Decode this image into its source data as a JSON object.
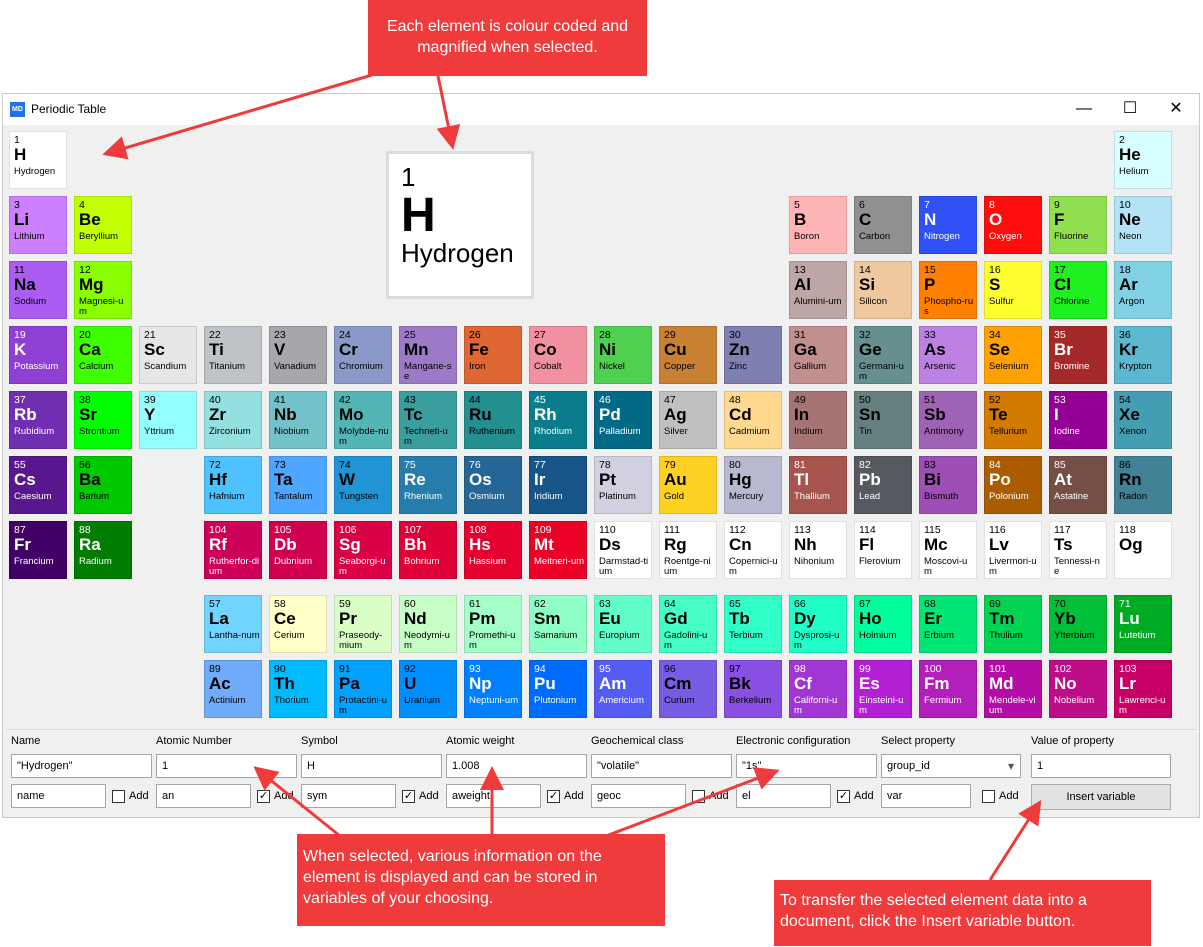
{
  "window": {
    "title": "Periodic Table",
    "app_icon": "MD",
    "controls": [
      "—",
      "☐",
      "✕"
    ]
  },
  "selected": {
    "number": "1",
    "symbol": "H",
    "name": "Hydrogen"
  },
  "elements": [
    {
      "n": "1",
      "s": "H",
      "name": "Hydrogen",
      "c": "#ffffff",
      "r": 0,
      "col": 0
    },
    {
      "n": "2",
      "s": "He",
      "name": "Helium",
      "c": "#d8ffff",
      "r": 0,
      "col": 17
    },
    {
      "n": "3",
      "s": "Li",
      "name": "Lithium",
      "c": "#cc80ff",
      "r": 1,
      "col": 0
    },
    {
      "n": "4",
      "s": "Be",
      "name": "Beryllium",
      "c": "#c2ff00",
      "r": 1,
      "col": 1
    },
    {
      "n": "5",
      "s": "B",
      "name": "Boron",
      "c": "#ffb5b5",
      "r": 1,
      "col": 12
    },
    {
      "n": "6",
      "s": "C",
      "name": "Carbon",
      "c": "#909090",
      "r": 1,
      "col": 13
    },
    {
      "n": "7",
      "s": "N",
      "name": "Nitrogen",
      "c": "#3050f8",
      "r": 1,
      "col": 14
    },
    {
      "n": "8",
      "s": "O",
      "name": "Oxygen",
      "c": "#ff0d0d",
      "r": 1,
      "col": 15
    },
    {
      "n": "9",
      "s": "F",
      "name": "Fluorine",
      "c": "#90e050",
      "r": 1,
      "col": 16
    },
    {
      "n": "10",
      "s": "Ne",
      "name": "Neon",
      "c": "#b3e3f5",
      "r": 1,
      "col": 17
    },
    {
      "n": "11",
      "s": "Na",
      "name": "Sodium",
      "c": "#ab5cf2",
      "r": 2,
      "col": 0
    },
    {
      "n": "12",
      "s": "Mg",
      "name": "Magnesi-um",
      "c": "#8aff00",
      "r": 2,
      "col": 1
    },
    {
      "n": "13",
      "s": "Al",
      "name": "Alumini-um",
      "c": "#bfa6a6",
      "r": 2,
      "col": 12
    },
    {
      "n": "14",
      "s": "Si",
      "name": "Silicon",
      "c": "#f0c8a0",
      "r": 2,
      "col": 13
    },
    {
      "n": "15",
      "s": "P",
      "name": "Phospho-rus",
      "c": "#ff8000",
      "r": 2,
      "col": 14
    },
    {
      "n": "16",
      "s": "S",
      "name": "Sulfur",
      "c": "#ffff30",
      "r": 2,
      "col": 15
    },
    {
      "n": "17",
      "s": "Cl",
      "name": "Chlorine",
      "c": "#1ff01f",
      "r": 2,
      "col": 16
    },
    {
      "n": "18",
      "s": "Ar",
      "name": "Argon",
      "c": "#80d1e3",
      "r": 2,
      "col": 17
    },
    {
      "n": "19",
      "s": "K",
      "name": "Potassium",
      "c": "#8f40d4",
      "r": 3,
      "col": 0
    },
    {
      "n": "20",
      "s": "Ca",
      "name": "Calcium",
      "c": "#3dff00",
      "r": 3,
      "col": 1
    },
    {
      "n": "21",
      "s": "Sc",
      "name": "Scandium",
      "c": "#e6e6e6",
      "r": 3,
      "col": 2
    },
    {
      "n": "22",
      "s": "Ti",
      "name": "Titanium",
      "c": "#bfc2c7",
      "r": 3,
      "col": 3
    },
    {
      "n": "23",
      "s": "V",
      "name": "Vanadium",
      "c": "#a6a6ab",
      "r": 3,
      "col": 4
    },
    {
      "n": "24",
      "s": "Cr",
      "name": "Chromium",
      "c": "#8a99c7",
      "r": 3,
      "col": 5
    },
    {
      "n": "25",
      "s": "Mn",
      "name": "Mangane-se",
      "c": "#9c7ac7",
      "r": 3,
      "col": 6
    },
    {
      "n": "26",
      "s": "Fe",
      "name": "Iron",
      "c": "#e06633",
      "r": 3,
      "col": 7
    },
    {
      "n": "27",
      "s": "Co",
      "name": "Cobalt",
      "c": "#f090a0",
      "r": 3,
      "col": 8
    },
    {
      "n": "28",
      "s": "Ni",
      "name": "Nickel",
      "c": "#50d050",
      "r": 3,
      "col": 9
    },
    {
      "n": "29",
      "s": "Cu",
      "name": "Copper",
      "c": "#c88033",
      "r": 3,
      "col": 10
    },
    {
      "n": "30",
      "s": "Zn",
      "name": "Zinc",
      "c": "#7d80b0",
      "r": 3,
      "col": 11
    },
    {
      "n": "31",
      "s": "Ga",
      "name": "Gallium",
      "c": "#c28f8f",
      "r": 3,
      "col": 12
    },
    {
      "n": "32",
      "s": "Ge",
      "name": "Germani-um",
      "c": "#668f8f",
      "r": 3,
      "col": 13
    },
    {
      "n": "33",
      "s": "As",
      "name": "Arsenic",
      "c": "#bd80e3",
      "r": 3,
      "col": 14
    },
    {
      "n": "34",
      "s": "Se",
      "name": "Selenium",
      "c": "#ffa100",
      "r": 3,
      "col": 15
    },
    {
      "n": "35",
      "s": "Br",
      "name": "Bromine",
      "c": "#a62929",
      "r": 3,
      "col": 16
    },
    {
      "n": "36",
      "s": "Kr",
      "name": "Krypton",
      "c": "#5cb8d1",
      "r": 3,
      "col": 17
    },
    {
      "n": "37",
      "s": "Rb",
      "name": "Rubidium",
      "c": "#702eb0",
      "r": 4,
      "col": 0
    },
    {
      "n": "38",
      "s": "Sr",
      "name": "Strontium",
      "c": "#00ff00",
      "r": 4,
      "col": 1
    },
    {
      "n": "39",
      "s": "Y",
      "name": "Yttrium",
      "c": "#94ffff",
      "r": 4,
      "col": 2
    },
    {
      "n": "40",
      "s": "Zr",
      "name": "Zirconium",
      "c": "#94e0e0",
      "r": 4,
      "col": 3
    },
    {
      "n": "41",
      "s": "Nb",
      "name": "Niobium",
      "c": "#73c2c9",
      "r": 4,
      "col": 4
    },
    {
      "n": "42",
      "s": "Mo",
      "name": "Molybde-num",
      "c": "#54b5b5",
      "r": 4,
      "col": 5
    },
    {
      "n": "43",
      "s": "Tc",
      "name": "Techneti-um",
      "c": "#3b9e9e",
      "r": 4,
      "col": 6
    },
    {
      "n": "44",
      "s": "Ru",
      "name": "Ruthenium",
      "c": "#248f8f",
      "r": 4,
      "col": 7
    },
    {
      "n": "45",
      "s": "Rh",
      "name": "Rhodium",
      "c": "#0a7d8c",
      "r": 4,
      "col": 8
    },
    {
      "n": "46",
      "s": "Pd",
      "name": "Palladium",
      "c": "#006985",
      "r": 4,
      "col": 9
    },
    {
      "n": "47",
      "s": "Ag",
      "name": "Silver",
      "c": "#c0c0c0",
      "r": 4,
      "col": 10
    },
    {
      "n": "48",
      "s": "Cd",
      "name": "Cadmium",
      "c": "#ffd98f",
      "r": 4,
      "col": 11
    },
    {
      "n": "49",
      "s": "In",
      "name": "Indium",
      "c": "#a67573",
      "r": 4,
      "col": 12
    },
    {
      "n": "50",
      "s": "Sn",
      "name": "Tin",
      "c": "#668080",
      "r": 4,
      "col": 13
    },
    {
      "n": "51",
      "s": "Sb",
      "name": "Antimony",
      "c": "#9e63b5",
      "r": 4,
      "col": 14
    },
    {
      "n": "52",
      "s": "Te",
      "name": "Tellurium",
      "c": "#d47a00",
      "r": 4,
      "col": 15
    },
    {
      "n": "53",
      "s": "I",
      "name": "Iodine",
      "c": "#940094",
      "r": 4,
      "col": 16
    },
    {
      "n": "54",
      "s": "Xe",
      "name": "Xenon",
      "c": "#429eb0",
      "r": 4,
      "col": 17
    },
    {
      "n": "55",
      "s": "Cs",
      "name": "Caesium",
      "c": "#57178f",
      "r": 5,
      "col": 0
    },
    {
      "n": "56",
      "s": "Ba",
      "name": "Barium",
      "c": "#00c900",
      "r": 5,
      "col": 1
    },
    {
      "n": "72",
      "s": "Hf",
      "name": "Hafnium",
      "c": "#4dc2ff",
      "r": 5,
      "col": 3
    },
    {
      "n": "73",
      "s": "Ta",
      "name": "Tantalum",
      "c": "#4da6ff",
      "r": 5,
      "col": 4
    },
    {
      "n": "74",
      "s": "W",
      "name": "Tungsten",
      "c": "#2194d6",
      "r": 5,
      "col": 5
    },
    {
      "n": "75",
      "s": "Re",
      "name": "Rhenium",
      "c": "#267dab",
      "r": 5,
      "col": 6
    },
    {
      "n": "76",
      "s": "Os",
      "name": "Osmium",
      "c": "#266696",
      "r": 5,
      "col": 7
    },
    {
      "n": "77",
      "s": "Ir",
      "name": "Iridium",
      "c": "#175487",
      "r": 5,
      "col": 8
    },
    {
      "n": "78",
      "s": "Pt",
      "name": "Platinum",
      "c": "#d0d0e0",
      "r": 5,
      "col": 9
    },
    {
      "n": "79",
      "s": "Au",
      "name": "Gold",
      "c": "#ffd123",
      "r": 5,
      "col": 10
    },
    {
      "n": "80",
      "s": "Hg",
      "name": "Mercury",
      "c": "#b8b8d0",
      "r": 5,
      "col": 11
    },
    {
      "n": "81",
      "s": "Tl",
      "name": "Thallium",
      "c": "#a6544d",
      "r": 5,
      "col": 12
    },
    {
      "n": "82",
      "s": "Pb",
      "name": "Lead",
      "c": "#575961",
      "r": 5,
      "col": 13
    },
    {
      "n": "83",
      "s": "Bi",
      "name": "Bismuth",
      "c": "#9e4fb5",
      "r": 5,
      "col": 14
    },
    {
      "n": "84",
      "s": "Po",
      "name": "Polonium",
      "c": "#ab5c00",
      "r": 5,
      "col": 15
    },
    {
      "n": "85",
      "s": "At",
      "name": "Astatine",
      "c": "#754f45",
      "r": 5,
      "col": 16
    },
    {
      "n": "86",
      "s": "Rn",
      "name": "Radon",
      "c": "#428296",
      "r": 5,
      "col": 17
    },
    {
      "n": "87",
      "s": "Fr",
      "name": "Francium",
      "c": "#420066",
      "r": 6,
      "col": 0
    },
    {
      "n": "88",
      "s": "Ra",
      "name": "Radium",
      "c": "#007d00",
      "r": 6,
      "col": 1
    },
    {
      "n": "104",
      "s": "Rf",
      "name": "Rutherfor-dium",
      "c": "#cc0059",
      "r": 6,
      "col": 3
    },
    {
      "n": "105",
      "s": "Db",
      "name": "Dubnium",
      "c": "#d1004f",
      "r": 6,
      "col": 4
    },
    {
      "n": "106",
      "s": "Sg",
      "name": "Seaborgi-um",
      "c": "#d90045",
      "r": 6,
      "col": 5
    },
    {
      "n": "107",
      "s": "Bh",
      "name": "Bohrium",
      "c": "#e00038",
      "r": 6,
      "col": 6
    },
    {
      "n": "108",
      "s": "Hs",
      "name": "Hassium",
      "c": "#e6002e",
      "r": 6,
      "col": 7
    },
    {
      "n": "109",
      "s": "Mt",
      "name": "Meitneri-um",
      "c": "#eb0026",
      "r": 6,
      "col": 8
    },
    {
      "n": "110",
      "s": "Ds",
      "name": "Darmstad-tium",
      "c": "#ffffff",
      "r": 6,
      "col": 9
    },
    {
      "n": "111",
      "s": "Rg",
      "name": "Roentge-nium",
      "c": "#ffffff",
      "r": 6,
      "col": 10
    },
    {
      "n": "112",
      "s": "Cn",
      "name": "Copernici-um",
      "c": "#ffffff",
      "r": 6,
      "col": 11
    },
    {
      "n": "113",
      "s": "Nh",
      "name": "Nihonium",
      "c": "#ffffff",
      "r": 6,
      "col": 12
    },
    {
      "n": "114",
      "s": "Fl",
      "name": "Flerovium",
      "c": "#ffffff",
      "r": 6,
      "col": 13
    },
    {
      "n": "115",
      "s": "Mc",
      "name": "Moscovi-um",
      "c": "#ffffff",
      "r": 6,
      "col": 14
    },
    {
      "n": "116",
      "s": "Lv",
      "name": "Livermori-um",
      "c": "#ffffff",
      "r": 6,
      "col": 15
    },
    {
      "n": "117",
      "s": "Ts",
      "name": "Tennessi-ne",
      "c": "#ffffff",
      "r": 6,
      "col": 16
    },
    {
      "n": "118",
      "s": "Og",
      "name": "",
      "c": "#ffffff",
      "r": 6,
      "col": 17
    },
    {
      "n": "57",
      "s": "La",
      "name": "Lantha-num",
      "c": "#70d4ff",
      "r": 7,
      "col": 3
    },
    {
      "n": "58",
      "s": "Ce",
      "name": "Cerium",
      "c": "#ffffc7",
      "r": 7,
      "col": 4
    },
    {
      "n": "59",
      "s": "Pr",
      "name": "Praseody-mium",
      "c": "#d9ffc7",
      "r": 7,
      "col": 5
    },
    {
      "n": "60",
      "s": "Nd",
      "name": "Neodymi-um",
      "c": "#c7ffc7",
      "r": 7,
      "col": 6
    },
    {
      "n": "61",
      "s": "Pm",
      "name": "Promethi-um",
      "c": "#a3ffc7",
      "r": 7,
      "col": 7
    },
    {
      "n": "62",
      "s": "Sm",
      "name": "Samarium",
      "c": "#8fffc7",
      "r": 7,
      "col": 8
    },
    {
      "n": "63",
      "s": "Eu",
      "name": "Europium",
      "c": "#61ffc7",
      "r": 7,
      "col": 9
    },
    {
      "n": "64",
      "s": "Gd",
      "name": "Gadolini-um",
      "c": "#45ffc7",
      "r": 7,
      "col": 10
    },
    {
      "n": "65",
      "s": "Tb",
      "name": "Terbium",
      "c": "#30ffc7",
      "r": 7,
      "col": 11
    },
    {
      "n": "66",
      "s": "Dy",
      "name": "Dysprosi-um",
      "c": "#1fffc7",
      "r": 7,
      "col": 12
    },
    {
      "n": "67",
      "s": "Ho",
      "name": "Holmium",
      "c": "#00ff9c",
      "r": 7,
      "col": 13
    },
    {
      "n": "68",
      "s": "Er",
      "name": "Erbium",
      "c": "#00e675",
      "r": 7,
      "col": 14
    },
    {
      "n": "69",
      "s": "Tm",
      "name": "Thulium",
      "c": "#00d452",
      "r": 7,
      "col": 15
    },
    {
      "n": "70",
      "s": "Yb",
      "name": "Ytterbium",
      "c": "#00bf38",
      "r": 7,
      "col": 16
    },
    {
      "n": "71",
      "s": "Lu",
      "name": "Lutetium",
      "c": "#00ab24",
      "r": 7,
      "col": 17
    },
    {
      "n": "89",
      "s": "Ac",
      "name": "Actinium",
      "c": "#70abfa",
      "r": 8,
      "col": 3
    },
    {
      "n": "90",
      "s": "Th",
      "name": "Thorium",
      "c": "#00baff",
      "r": 8,
      "col": 4
    },
    {
      "n": "91",
      "s": "Pa",
      "name": "Protactini-um",
      "c": "#00a1ff",
      "r": 8,
      "col": 5
    },
    {
      "n": "92",
      "s": "U",
      "name": "Uranium",
      "c": "#008fff",
      "r": 8,
      "col": 6
    },
    {
      "n": "93",
      "s": "Np",
      "name": "Neptuni-um",
      "c": "#0080ff",
      "r": 8,
      "col": 7
    },
    {
      "n": "94",
      "s": "Pu",
      "name": "Plutonium",
      "c": "#006bff",
      "r": 8,
      "col": 8
    },
    {
      "n": "95",
      "s": "Am",
      "name": "Americium",
      "c": "#545cf2",
      "r": 8,
      "col": 9
    },
    {
      "n": "96",
      "s": "Cm",
      "name": "Curium",
      "c": "#785ce3",
      "r": 8,
      "col": 10
    },
    {
      "n": "97",
      "s": "Bk",
      "name": "Berkelium",
      "c": "#8a4fe3",
      "r": 8,
      "col": 11
    },
    {
      "n": "98",
      "s": "Cf",
      "name": "Californi-um",
      "c": "#a136d4",
      "r": 8,
      "col": 12
    },
    {
      "n": "99",
      "s": "Es",
      "name": "Einsteini-um",
      "c": "#b31fd4",
      "r": 8,
      "col": 13
    },
    {
      "n": "100",
      "s": "Fm",
      "name": "Fermium",
      "c": "#b31fba",
      "r": 8,
      "col": 14
    },
    {
      "n": "101",
      "s": "Md",
      "name": "Mendele-vium",
      "c": "#b30da6",
      "r": 8,
      "col": 15
    },
    {
      "n": "102",
      "s": "No",
      "name": "Nobelium",
      "c": "#bd0d87",
      "r": 8,
      "col": 16
    },
    {
      "n": "103",
      "s": "Lr",
      "name": "Lawrenci-um",
      "c": "#c70066",
      "r": 8,
      "col": 17
    }
  ],
  "form": {
    "labels": {
      "name": "Name",
      "atomic_number": "Atomic Number",
      "symbol": "Symbol",
      "atomic_weight": "Atomic weight",
      "geochemical_class": "Geochemical class",
      "electronic_configuration": "Electronic configuration",
      "select_property": "Select property",
      "value_of_property": "Value of property"
    },
    "values": {
      "name": "\"Hydrogen\"",
      "atomic_number": "1",
      "symbol": "H",
      "atomic_weight": "1.008",
      "geochemical_class": "\"volatile\"",
      "electronic_configuration": "\"1s\"",
      "select_property": "group_id",
      "value_of_property": "1"
    },
    "variables": {
      "name": "name",
      "atomic_number": "an",
      "symbol": "sym",
      "atomic_weight": "aweight",
      "geochemical_class": "geoc",
      "electronic_configuration": "el",
      "select_property": "var"
    },
    "add_checked": {
      "name": false,
      "atomic_number": true,
      "symbol": true,
      "atomic_weight": true,
      "geochemical_class": false,
      "electronic_configuration": true,
      "select_property": false
    },
    "add_label": "Add",
    "insert_button": "Insert variable"
  },
  "callouts": {
    "top": "Each element is colour coded and magnified when selected.",
    "middle": "When selected, various information on the element is displayed and can be stored in variables of your choosing.",
    "right": "To transfer the selected element data into a document, click the Insert variable button."
  },
  "accent_color": "#ef3b3b"
}
